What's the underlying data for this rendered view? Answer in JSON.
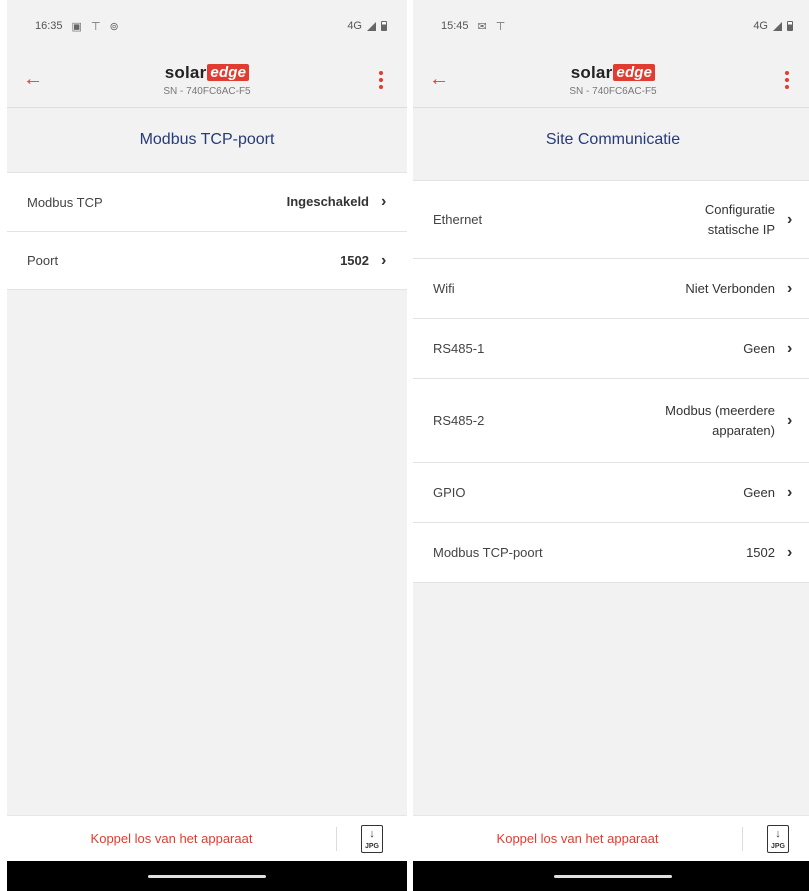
{
  "left": {
    "status": {
      "time": "16:35",
      "icons": [
        "image-icon",
        "signal-antenna-icon",
        "settings-icon"
      ],
      "network": "4G"
    },
    "header": {
      "logo_solar": "solar",
      "logo_edge": "edge",
      "serial": "SN - 740FC6AC-F5"
    },
    "title": "Modbus TCP-poort",
    "rows": [
      {
        "label": "Modbus TCP",
        "value": "Ingeschakeld"
      },
      {
        "label": "Poort",
        "value": "1502"
      }
    ],
    "footer": {
      "disconnect_label": "Koppel los van het apparaat",
      "jpg_label": "JPG"
    }
  },
  "right": {
    "status": {
      "time": "15:45",
      "icons": [
        "mail-icon",
        "signal-antenna-icon"
      ],
      "network": "4G"
    },
    "header": {
      "logo_solar": "solar",
      "logo_edge": "edge",
      "serial": "SN - 740FC6AC-F5"
    },
    "title": "Site Communicatie",
    "rows": [
      {
        "label": "Ethernet",
        "value_line1": "Configuratie",
        "value_line2": "statische IP"
      },
      {
        "label": "Wifi",
        "value": "Niet Verbonden"
      },
      {
        "label": "RS485-1",
        "value": "Geen"
      },
      {
        "label": "RS485-2",
        "value_line1": "Modbus (meerdere",
        "value_line2": "apparaten)"
      },
      {
        "label": "GPIO",
        "value": "Geen"
      },
      {
        "label": "Modbus TCP-poort",
        "value": "1502"
      }
    ],
    "footer": {
      "disconnect_label": "Koppel los van het apparaat",
      "jpg_label": "JPG"
    }
  },
  "icons": {
    "back": "arrow-left-icon",
    "menu": "kebab-menu-icon",
    "chevron": "chevron-right-icon",
    "export": "jpg-download-icon"
  },
  "colors": {
    "accent": "#e03c31",
    "title": "#253b7a",
    "background": "#f2f2f2",
    "navbar": "#000000"
  }
}
